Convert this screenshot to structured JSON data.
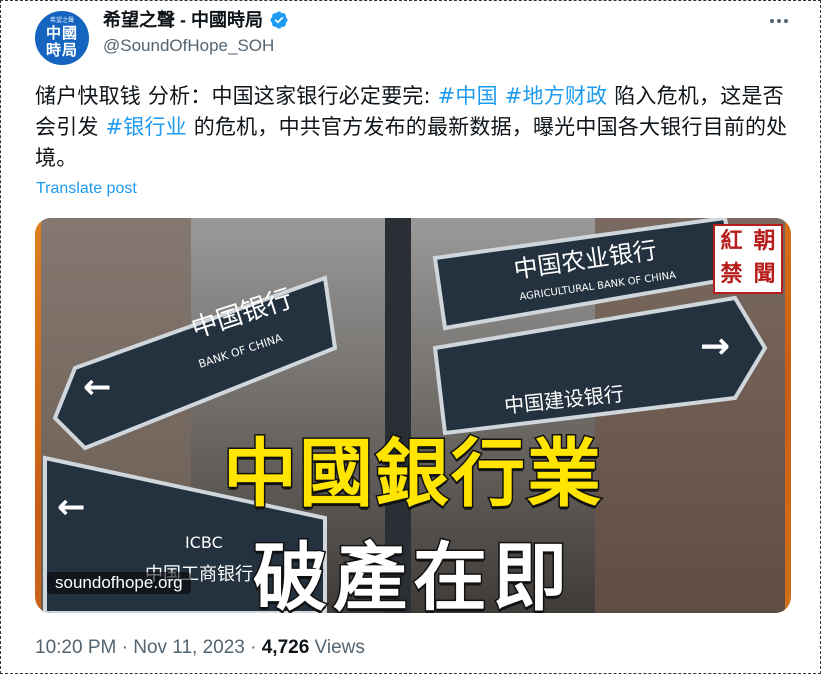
{
  "account": {
    "avatar_top_text": "希望之聲",
    "avatar_text_line1": "中國",
    "avatar_text_line2": "時局",
    "display_name": "希望之聲 - 中國時局",
    "handle": "@SoundOfHope_SOH",
    "verified_icon": "verified-badge-icon"
  },
  "tweet": {
    "text_part1": "储户快取钱 分析：中国这家银行必定要完: ",
    "tag1": "#中国",
    "text_sep1": " ",
    "tag2": "#地方财政",
    "text_part2": " 陷入危机，这是否会引发 ",
    "tag3": "#银行业",
    "text_part3": " 的危机，中共官方发布的最新数据，曝光中国各大银行目前的处境。",
    "translate_label": "Translate post"
  },
  "media": {
    "headline_line1": "中國銀行業",
    "headline_line2": "破產在即",
    "watermark": "soundofhope.org",
    "badge_chars": [
      "紅",
      "朝",
      "禁",
      "聞"
    ],
    "sign_boc_cn": "中国银行",
    "sign_boc_en": "BANK OF CHINA",
    "sign_abc_cn": "中国农业银行",
    "sign_abc_en": "AGRICULTURAL BANK OF CHINA",
    "sign_ccb_cn": "中国建设银行",
    "sign_icbc_en": "ICBC",
    "sign_icbc_cn": "中国工商银行"
  },
  "meta": {
    "time": "10:20 PM",
    "sep1": " · ",
    "date": "Nov 11, 2023",
    "sep2": " · ",
    "views_count": "4,726",
    "views_label": " Views"
  },
  "colors": {
    "link": "#1d9bf0",
    "secondary_text": "#536471",
    "headline_yellow": "#ffe500",
    "media_orange": "#e0801c"
  }
}
